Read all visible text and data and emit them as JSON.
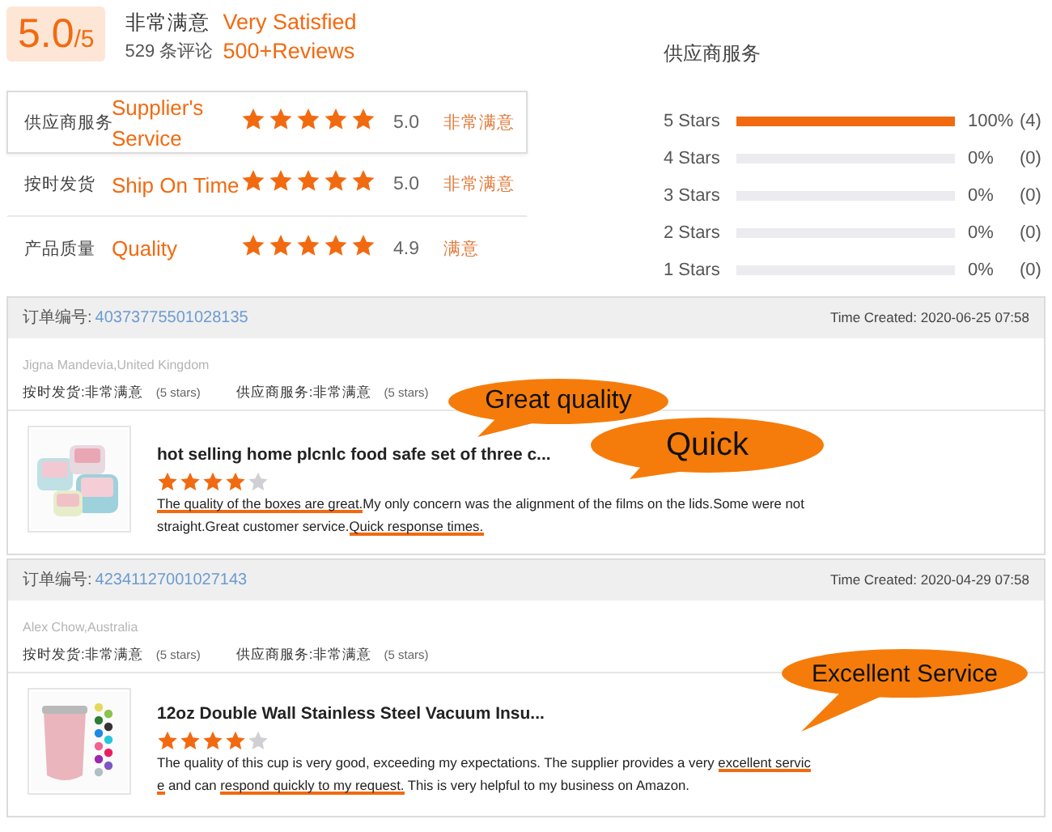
{
  "summary": {
    "score": "5.0",
    "out_of": "/5",
    "verdict": "非常满意",
    "verdict_en": "Very Satisfied",
    "review_count": "529 条评论",
    "review_count_en": "500+Reviews",
    "ratings": [
      {
        "label": "供应商服务",
        "label_en": "Supplier's Service",
        "stars": 5,
        "score": "5.0",
        "verdict": "非常满意",
        "selected": true
      },
      {
        "label": "按时发货",
        "label_en": "Ship On Time",
        "stars": 5,
        "score": "5.0",
        "verdict": "非常满意",
        "selected": false
      },
      {
        "label": "产品质量",
        "label_en": "Quality",
        "stars": 5,
        "score": "4.9",
        "verdict": "满意",
        "selected": false
      }
    ]
  },
  "distribution": {
    "title": "供应商服务",
    "rows": [
      {
        "label": "5 Stars",
        "level": 1,
        "percent": "100%",
        "count": "(4)"
      },
      {
        "label": "4 Stars",
        "level": 0,
        "percent": "0%",
        "count": "(0)"
      },
      {
        "label": "3 Stars",
        "level": 0,
        "percent": "0%",
        "count": "(0)"
      },
      {
        "label": "2 Stars",
        "level": 0,
        "percent": "0%",
        "count": "(0)"
      },
      {
        "label": "1 Stars",
        "level": 0,
        "percent": "0%",
        "count": "(0)"
      }
    ]
  },
  "reviews": [
    {
      "order_label": "订单编号:",
      "order_number": "40373775501028135",
      "time": "Time Created: 2020-06-25 07:58",
      "buyer": "Jigna Mandevia,United Kingdom",
      "ratings": [
        {
          "label": "按时发货:",
          "verdict": "非常满意",
          "note": "(5 stars)"
        },
        {
          "label": "供应商服务:",
          "verdict": "非常满意",
          "note": "(5 stars)"
        }
      ],
      "product": "hot selling home plcnlc food safe set of three c...",
      "image": {
        "kind": "picture"
      },
      "stars": 4,
      "text": [
        {
          "text": "The quality of the boxes are great.",
          "highlighted": true
        },
        {
          "text": "My only concern was the alignment of the films on the lids.Some were not straight.Great customer service.",
          "highlighted": false
        },
        {
          "text": "Quick response times.",
          "highlighted": true
        }
      ],
      "callouts": [
        {
          "text": "Great quality"
        },
        {
          "text": "Quick"
        }
      ]
    },
    {
      "order_label": "订单编号:",
      "order_number": "42341127001027143",
      "time": "Time Created: 2020-04-29 07:58",
      "buyer": "Alex Chow,Australia",
      "ratings": [
        {
          "label": "按时发货:",
          "verdict": "非常满意",
          "note": "(5 stars)"
        },
        {
          "label": "供应商服务:",
          "verdict": "非常满意",
          "note": "(5 stars)"
        }
      ],
      "product": "12oz Double Wall Stainless Steel Vacuum Insu...",
      "image": {
        "kind": "picture"
      },
      "stars": 4,
      "text": [
        {
          "text": "The quality of this cup is very good, exceeding my expectations. The supplier provides a very ",
          "highlighted": false
        },
        {
          "text": "excellent service",
          "highlighted": true
        },
        {
          "text": " and can ",
          "highlighted": false
        },
        {
          "text": "respond quickly to my request.",
          "highlighted": true
        },
        {
          "text": " This is very helpful to my business on Amazon.",
          "highlighted": false
        }
      ],
      "callouts": [
        {
          "text": "Excellent Service"
        }
      ]
    }
  ]
}
